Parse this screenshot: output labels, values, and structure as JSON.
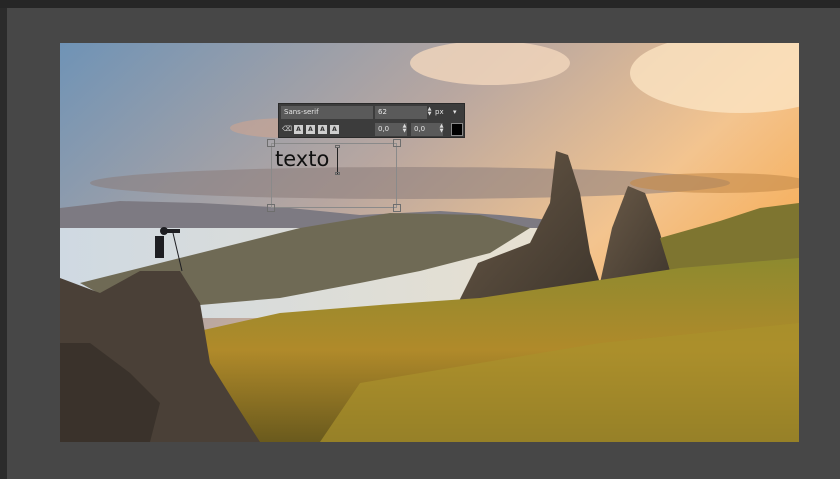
{
  "toolbar": {
    "font": "Sans-serif",
    "size": "62",
    "unit": "px",
    "line_spacing": "0,0",
    "letter_spacing": "0,0",
    "style_buttons": [
      "A",
      "A",
      "A",
      "A"
    ]
  },
  "canvas": {
    "text": "texto"
  },
  "colors": {
    "text_color": "#000000",
    "workspace": "#474747"
  },
  "icons": {
    "clear": "eraser-icon",
    "unit_dropdown": "chevron-down-icon",
    "spin": "spin-arrows-icon"
  }
}
